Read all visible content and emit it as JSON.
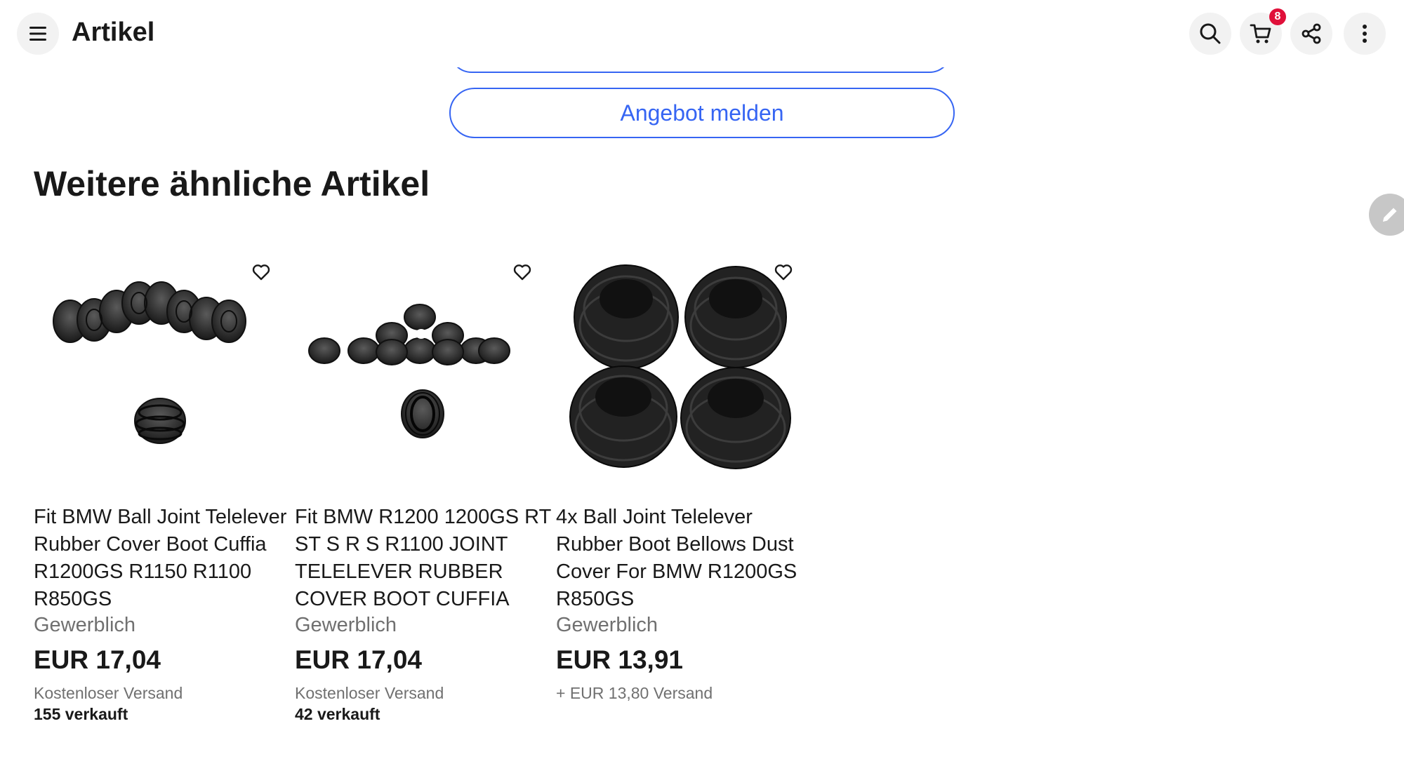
{
  "header": {
    "title": "Artikel",
    "cart_count": "8",
    "icons": [
      "menu-icon",
      "search-icon",
      "cart-icon",
      "share-icon",
      "more-icon"
    ]
  },
  "actions": {
    "offer_label": "Angebot melden"
  },
  "section": {
    "title": "Weitere ähnliche Artikel"
  },
  "products": [
    {
      "title": "Fit BMW Ball Joint Telelever Rubber Cover Boot Cuffia R1200GS R1150 R1100 R850GS",
      "seller_type": "Gewerblich",
      "price": "EUR 17,04",
      "shipping": "Kostenloser Versand",
      "sold": "155 verkauft"
    },
    {
      "title": "Fit BMW R1200 1200GS RT ST S R S R1100 JOINT TELELEVER RUBBER COVER BOOT CUFFIA",
      "seller_type": "Gewerblich",
      "price": "EUR 17,04",
      "shipping": "Kostenloser Versand",
      "sold": "42 verkauft"
    },
    {
      "title": "4x Ball Joint Telelever Rubber Boot Bellows Dust Cover For BMW R1200GS R850GS",
      "seller_type": "Gewerblich",
      "price": "EUR 13,91",
      "shipping": "+ EUR 13,80 Versand",
      "sold": ""
    }
  ],
  "colors": {
    "accent": "#3665f3",
    "badge": "#e0103a",
    "text": "#191919",
    "muted": "#707070"
  }
}
